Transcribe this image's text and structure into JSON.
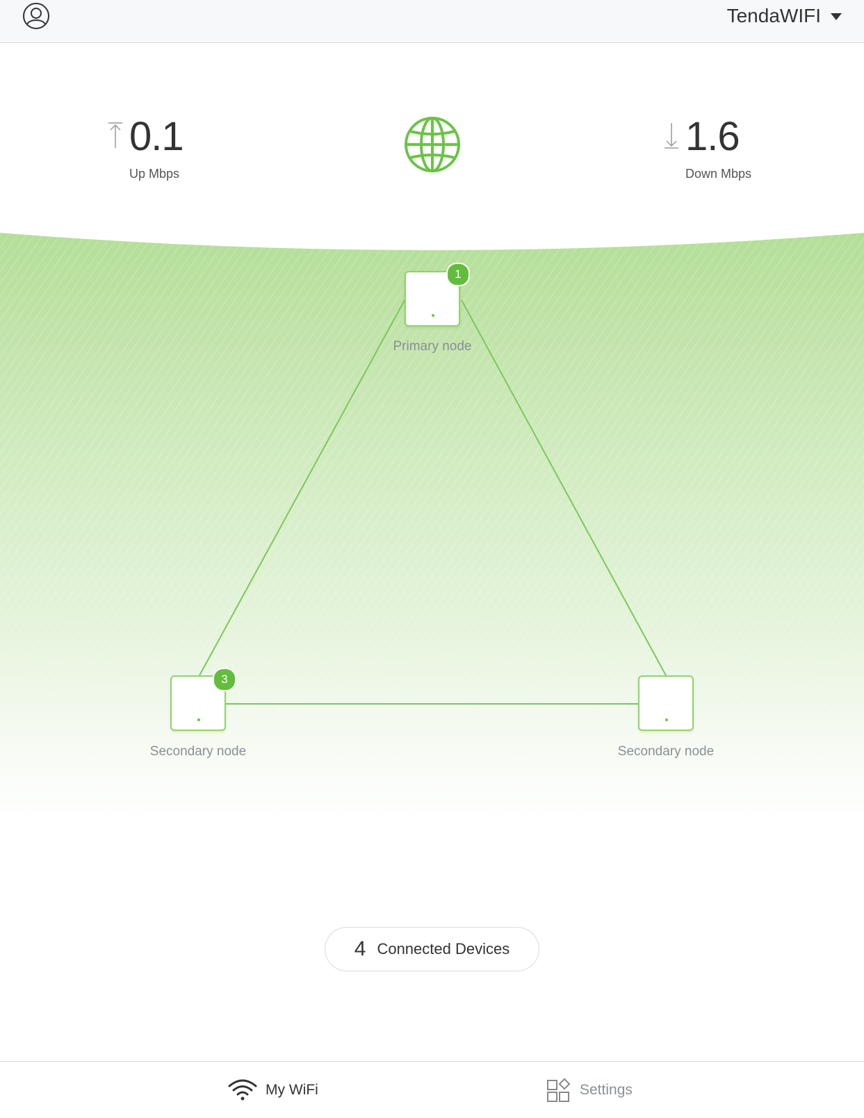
{
  "header": {
    "avatar_icon": "user-circle-icon",
    "network_name": "TendaWIFI",
    "dropdown_icon": "caret-down-icon"
  },
  "speed": {
    "up": {
      "value": "0.1",
      "unit": "Up Mbps",
      "icon": "arrow-up-icon"
    },
    "down": {
      "value": "1.6",
      "unit": "Down Mbps",
      "icon": "arrow-down-icon"
    },
    "internet_icon": "globe-icon"
  },
  "topology": {
    "primary": {
      "label": "Primary node",
      "badge": "1"
    },
    "secondary_left": {
      "label": "Secondary node",
      "badge": "3"
    },
    "secondary_right": {
      "label": "Secondary node"
    }
  },
  "devices": {
    "count": "4",
    "label": "Connected Devices"
  },
  "tabbar": {
    "my_wifi": {
      "label": "My WiFi",
      "icon": "wifi-icon"
    },
    "settings": {
      "label": "Settings",
      "icon": "settings-grid-icon"
    }
  },
  "colors": {
    "accent": "#62bd3c",
    "line": "#7bc95a",
    "background_green": "#b8e0a0"
  }
}
